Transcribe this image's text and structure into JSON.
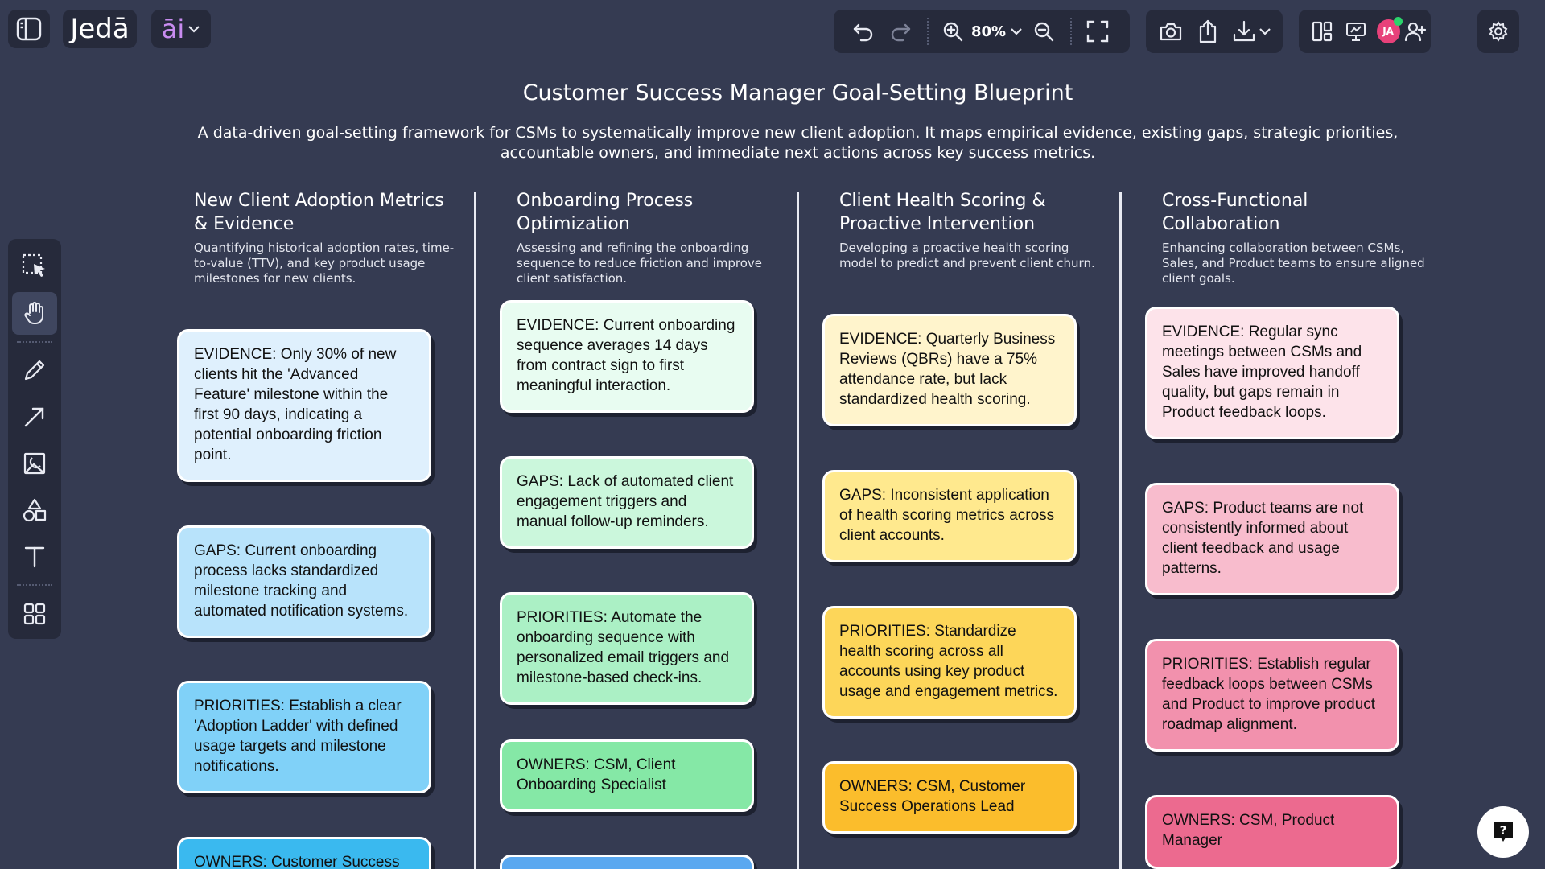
{
  "app": {
    "logo_text": "Jedā",
    "ai_text": "āi"
  },
  "toolbar": {
    "zoom_label": "80%"
  },
  "user": {
    "avatar_initials": "JA"
  },
  "board": {
    "title": "Customer Success Manager Goal-Setting Blueprint",
    "description": "A data-driven goal-setting framework for CSMs to systematically improve new client adoption. It maps empirical evidence, existing gaps, strategic priorities, accountable owners, and immediate next actions across key success metrics."
  },
  "columns": [
    {
      "title": "New Client Adoption Metrics & Evidence",
      "subtitle": "Quantifying historical adoption rates, time-to-value (TTV), and key product usage milestones for new clients.",
      "cards": [
        {
          "text": "EVIDENCE: Only 30% of new clients hit the 'Advanced Feature' milestone within the first 90 days, indicating a potential onboarding friction point.",
          "color": "#dff0fd"
        },
        {
          "text": "GAPS: Current onboarding process lacks standardized milestone tracking and automated notification systems.",
          "color": "#b8e3fb"
        },
        {
          "text": "PRIORITIES: Establish a clear 'Adoption Ladder' with defined usage targets and milestone notifications.",
          "color": "#80d1f8"
        },
        {
          "text": "OWNERS: Customer Success",
          "color": "#3ab9ef"
        }
      ]
    },
    {
      "title": "Onboarding Process Optimization",
      "subtitle": "Assessing and refining the onboarding sequence to reduce friction and improve client satisfaction.",
      "cards": [
        {
          "text": "EVIDENCE: Current onboarding sequence averages 14 days from contract sign to first meaningful interaction.",
          "color": "#e8fcf1"
        },
        {
          "text": "GAPS: Lack of automated client engagement triggers and manual follow-up reminders.",
          "color": "#cbf7dc"
        },
        {
          "text": "PRIORITIES: Automate the onboarding sequence with personalized email triggers and milestone-based check-ins.",
          "color": "#abf0c5"
        },
        {
          "text": "OWNERS: CSM, Client Onboarding Specialist",
          "color": "#85e8a6"
        },
        {
          "text": "",
          "color": "#5aa8f0"
        }
      ]
    },
    {
      "title": "Client Health Scoring & Proactive Intervention",
      "subtitle": "Developing a proactive health scoring model to predict and prevent client churn.",
      "cards": [
        {
          "text": "EVIDENCE: Quarterly Business Reviews (QBRs) have a 75% attendance rate, but lack standardized health scoring.",
          "color": "#fff4cc"
        },
        {
          "text": "GAPS: Inconsistent application of health scoring metrics across client accounts.",
          "color": "#ffe98e"
        },
        {
          "text": "PRIORITIES: Standardize health scoring across all accounts using key product usage and engagement metrics.",
          "color": "#fdd659"
        },
        {
          "text": "OWNERS: CSM, Customer Success Operations Lead",
          "color": "#fbbd2c"
        }
      ]
    },
    {
      "title": "Cross-Functional Collaboration",
      "subtitle": "Enhancing collaboration between CSMs, Sales, and Product teams to ensure aligned client goals.",
      "cards": [
        {
          "text": "EVIDENCE: Regular sync meetings between CSMs and Sales have improved handoff quality, but gaps remain in Product feedback loops.",
          "color": "#fde3ea"
        },
        {
          "text": "GAPS: Product teams are not consistently informed about client feedback and usage patterns.",
          "color": "#f8bccd"
        },
        {
          "text": "PRIORITIES: Establish regular feedback loops between CSMs and Product to improve product roadmap alignment.",
          "color": "#f291ad"
        },
        {
          "text": "OWNERS: CSM, Product Manager",
          "color": "#ec6a8f"
        }
      ]
    }
  ],
  "icons": {
    "sidebar_toggle": "sidebar-toggle-icon",
    "undo": "undo-icon",
    "redo": "redo-icon",
    "zoom_in": "zoom-in-icon",
    "zoom_out": "zoom-out-icon",
    "fullscreen": "fullscreen-icon",
    "camera": "camera-icon",
    "upload": "upload-icon",
    "download": "download-icon",
    "layout": "layout-icon",
    "present": "present-icon",
    "add_user": "add-user-icon",
    "settings": "gear-icon",
    "help": "help-icon"
  }
}
